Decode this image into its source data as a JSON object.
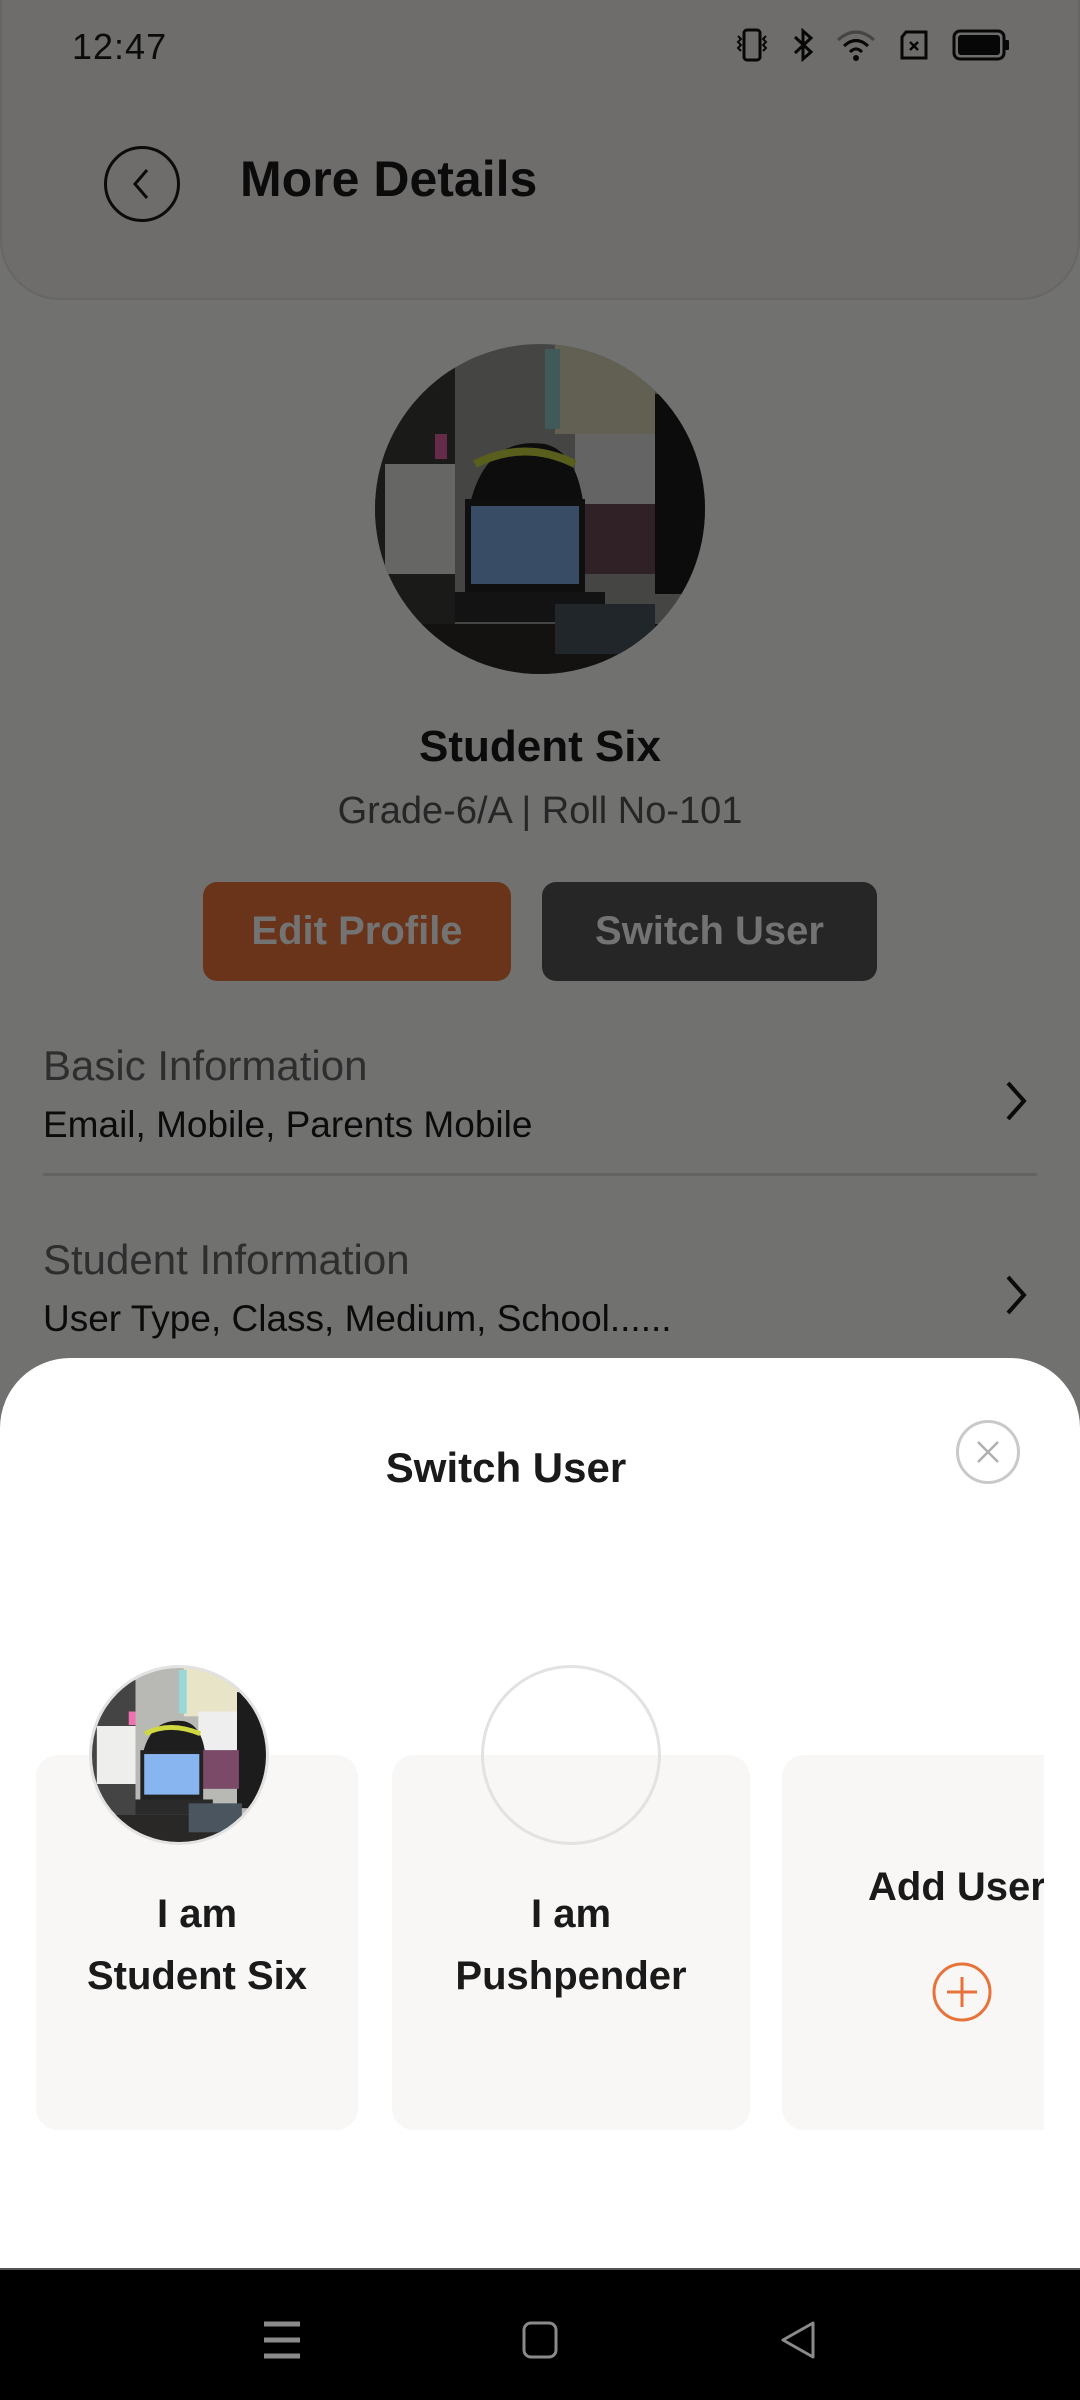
{
  "status_bar": {
    "time": "12:47",
    "icons": [
      "vibrate-icon",
      "bluetooth-icon",
      "wifi-icon",
      "no-sim-icon",
      "battery-icon"
    ]
  },
  "header": {
    "back_icon": "chevron-left-circle-icon",
    "title": "More Details"
  },
  "profile": {
    "name": "Student Six",
    "subtitle": "Grade-6/A | Roll No-101",
    "edit_button": "Edit Profile",
    "switch_button": "Switch User",
    "accent_color": "#e8733a"
  },
  "info_sections": [
    {
      "title": "Basic Information",
      "description": "Email, Mobile, Parents Mobile"
    },
    {
      "title": "Student Information",
      "description": "User Type, Class, Medium, School......"
    }
  ],
  "switch_sheet": {
    "title": "Switch User",
    "close_icon": "close-circle-icon",
    "users": [
      {
        "line1": "I am",
        "line2": "Student Six",
        "has_photo": true
      },
      {
        "line1": "I am",
        "line2": "Pushpender",
        "has_photo": false
      }
    ],
    "add_user": {
      "label": "Add User",
      "icon": "plus-circle-icon"
    }
  },
  "nav_bar": {
    "buttons": [
      "menu-icon",
      "home-icon",
      "back-icon"
    ]
  }
}
